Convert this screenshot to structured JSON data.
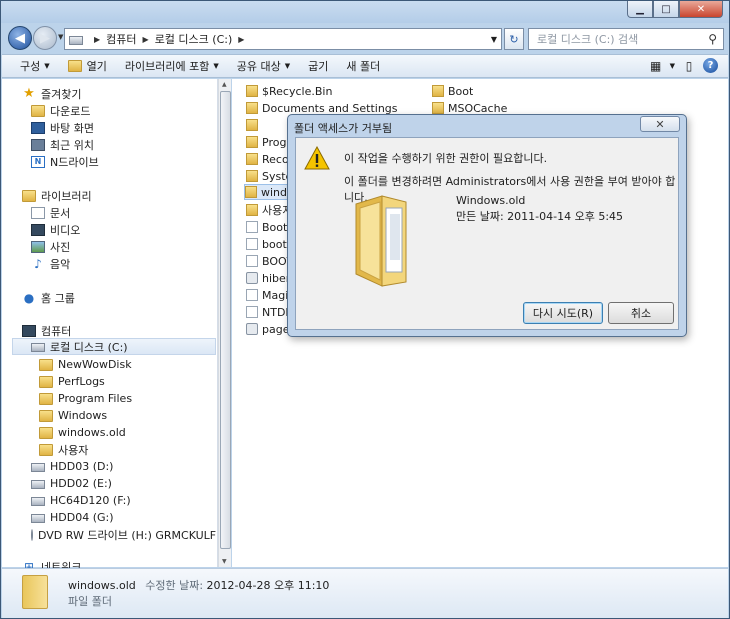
{
  "window": {
    "controls": {
      "minimize": "▁",
      "maximize": "□",
      "close": "✕"
    }
  },
  "address": {
    "crumbs": [
      "컴퓨터",
      "로컬 디스크 (C:)"
    ],
    "search_placeholder": "로컬 디스크 (C:) 검색"
  },
  "toolbar": {
    "organize": "구성",
    "open": "열기",
    "include_library": "라이브러리에 포함",
    "share": "공유 대상",
    "burn": "굽기",
    "new_folder": "새 폴더"
  },
  "nav": {
    "favorites": "즐겨찾기",
    "downloads": "다운로드",
    "desktop": "바탕 화면",
    "recent": "최근 위치",
    "ndrive": "N드라이브",
    "libraries": "라이브러리",
    "documents": "문서",
    "video": "비디오",
    "pictures": "사진",
    "music": "음악",
    "homegroup": "홈 그룹",
    "computer": "컴퓨터",
    "local_disk": "로컬 디스크 (C:)",
    "folders": [
      "NewWowDisk",
      "PerfLogs",
      "Program Files",
      "Windows",
      "windows.old",
      "사용자"
    ],
    "drives": [
      "HDD03 (D:)",
      "HDD02 (E:)",
      "HC64D120 (F:)",
      "HDD04 (G:)",
      "DVD RW 드라이브 (H:) GRMCKULFRER"
    ],
    "network": "네트워크"
  },
  "files": {
    "col1": [
      "$Recycle.Bin",
      "Documents and Settings",
      "",
      "Progra",
      "Recove",
      "System",
      "windo",
      "사용지",
      "Boot.B",
      "bootfo",
      "BOOTS",
      "hiberfi",
      "Magic",
      "NTDET",
      "pagefi"
    ],
    "col2": [
      "Boot",
      "MSOCache"
    ]
  },
  "dialog": {
    "title": "폴더 액세스가 거부됨",
    "close": "✕",
    "message1": "이 작업을 수행하기 위한 권한이 필요합니다.",
    "message2": "이 폴더를 변경하려면 Administrators에서 사용 권한을 부여 받아야 합니다.",
    "folder_name": "Windows.old",
    "folder_date": "만든 날짜: 2011-04-14 오후 5:45",
    "retry": "다시 시도(R)",
    "cancel": "취소"
  },
  "status": {
    "name": "windows.old",
    "modified_label": "수정한 날짜:",
    "modified": "2012-04-28 오후 11:10",
    "type": "파일 폴더"
  }
}
